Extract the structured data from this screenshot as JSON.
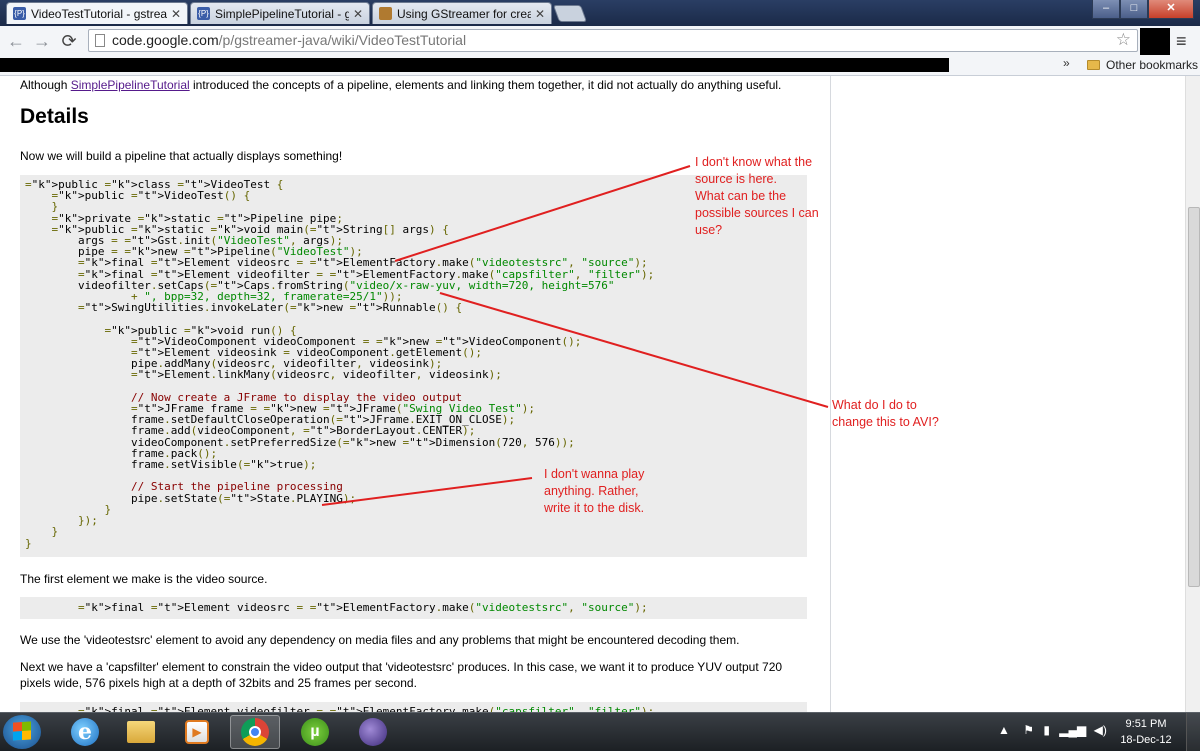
{
  "tabs": [
    {
      "title": "VideoTestTutorial - gstrea",
      "favicon": "{P}",
      "active": true
    },
    {
      "title": "SimplePipelineTutorial - g",
      "favicon": "{P}",
      "active": false
    },
    {
      "title": "Using GStreamer for creat",
      "favicon": "",
      "active": false
    }
  ],
  "window": {
    "min": "–",
    "max": "□",
    "close": "✕"
  },
  "toolbar": {
    "url_host": "code.google.com",
    "url_path": "/p/gstreamer-java/wiki/VideoTestTutorial",
    "back_icon": "back-arrow-icon",
    "forward_icon": "forward-arrow-icon",
    "reload_icon": "reload-icon"
  },
  "bookmarks": {
    "overflow": "»",
    "other": "Other bookmarks"
  },
  "content": {
    "intro_before": "Although ",
    "intro_link": "SimplePipelineTutorial",
    "intro_after": " introduced the concepts of a pipeline, elements and linking them together, it did not actually do anything useful.",
    "heading": "Details",
    "lead": "Now we will build a pipeline that actually displays something!",
    "code_lines": [
      "public class VideoTest {",
      "    public VideoTest() {",
      "    }",
      "    private static Pipeline pipe;",
      "    public static void main(String[] args) {",
      "        args = Gst.init(\"VideoTest\", args);",
      "        pipe = new Pipeline(\"VideoTest\");",
      "        final Element videosrc = ElementFactory.make(\"videotestsrc\", \"source\");",
      "        final Element videofilter = ElementFactory.make(\"capsfilter\", \"filter\");",
      "        videofilter.setCaps(Caps.fromString(\"video/x-raw-yuv, width=720, height=576\"",
      "                + \", bpp=32, depth=32, framerate=25/1\"));",
      "        SwingUtilities.invokeLater(new Runnable() {",
      "",
      "            public void run() {",
      "                VideoComponent videoComponent = new VideoComponent();",
      "                Element videosink = videoComponent.getElement();",
      "                pipe.addMany(videosrc, videofilter, videosink);",
      "                Element.linkMany(videosrc, videofilter, videosink);",
      "",
      "                // Now create a JFrame to display the video output",
      "                JFrame frame = new JFrame(\"Swing Video Test\");",
      "                frame.setDefaultCloseOperation(JFrame.EXIT_ON_CLOSE);",
      "                frame.add(videoComponent, BorderLayout.CENTER);",
      "                videoComponent.setPreferredSize(new Dimension(720, 576));",
      "                frame.pack();",
      "                frame.setVisible(true);",
      "",
      "                // Start the pipeline processing",
      "                pipe.setState(State.PLAYING);",
      "            }",
      "        });",
      "    }",
      "}"
    ],
    "p1": "The first element we make is the video source.",
    "snippet1": "        final Element videosrc = ElementFactory.make(\"videotestsrc\", \"source\");",
    "p2": "We use the 'videotestsrc' element to avoid any dependency on media files and any problems that might be encountered decoding them.",
    "p3_line1": "Next we have a 'capsfilter' element to constrain the video output that 'videotestsrc' produces. In this case, we want it to produce YUV output 720",
    "p3_line2": "pixels wide, 576 pixels high at a depth of 32bits and 25 frames per second.",
    "snippet2": "        final Element videofilter = ElementFactory.make(\"capsfilter\", \"filter\");"
  },
  "annotations": {
    "a1": [
      "I don't know what the",
      "source is here.",
      "What can be the",
      "possible sources I can",
      "use?"
    ],
    "a2": [
      "What do I do to",
      "change this to AVI?"
    ],
    "a3": [
      "I don't wanna play",
      "anything. Rather,",
      "write it to the disk."
    ],
    "color": "#e02020"
  },
  "taskbar": {
    "apps": [
      "internet-explorer-icon",
      "file-explorer-icon",
      "media-player-icon",
      "chrome-icon",
      "utorrent-icon",
      "eclipse-icon"
    ],
    "time": "9:51 PM",
    "date": "18-Dec-12"
  }
}
